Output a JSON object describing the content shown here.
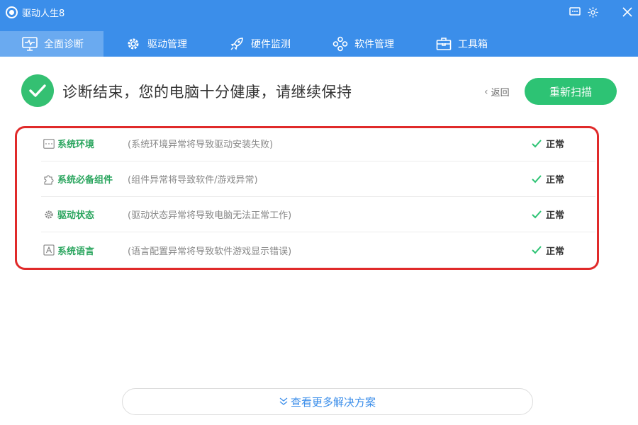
{
  "app": {
    "title": "驱动人生8"
  },
  "tabs": [
    {
      "label": "全面诊断",
      "icon": "monitor-pulse-icon",
      "active": true
    },
    {
      "label": "驱动管理",
      "icon": "gear-icon",
      "active": false
    },
    {
      "label": "硬件监测",
      "icon": "rocket-icon",
      "active": false
    },
    {
      "label": "软件管理",
      "icon": "apps-grid-icon",
      "active": false
    },
    {
      "label": "工具箱",
      "icon": "toolbox-icon",
      "active": false
    }
  ],
  "window_controls": [
    "feedback-icon",
    "settings-icon",
    "close-icon"
  ],
  "header": {
    "headline": "诊断结束，您的电脑十分健康，请继续保持",
    "back_label": "返回",
    "rescan_label": "重新扫描"
  },
  "diagnostics": [
    {
      "name": "系统环境",
      "description": "(系统环境异常将导致驱动安装失败)",
      "status": "正常",
      "icon": "window-icon"
    },
    {
      "name": "系统必备组件",
      "description": "(组件异常将导致软件/游戏异常)",
      "status": "正常",
      "icon": "puzzle-icon"
    },
    {
      "name": "驱动状态",
      "description": "(驱动状态异常将导致电脑无法正常工作)",
      "status": "正常",
      "icon": "gear-icon"
    },
    {
      "name": "系统语言",
      "description": "(语言配置异常将导致软件游戏显示错误)",
      "status": "正常",
      "icon": "letter-a-icon"
    }
  ],
  "footer": {
    "more_label": "查看更多解决方案"
  },
  "colors": {
    "brand": "#3b8eea",
    "success": "#2dc374",
    "highlight": "#e02a2a"
  }
}
